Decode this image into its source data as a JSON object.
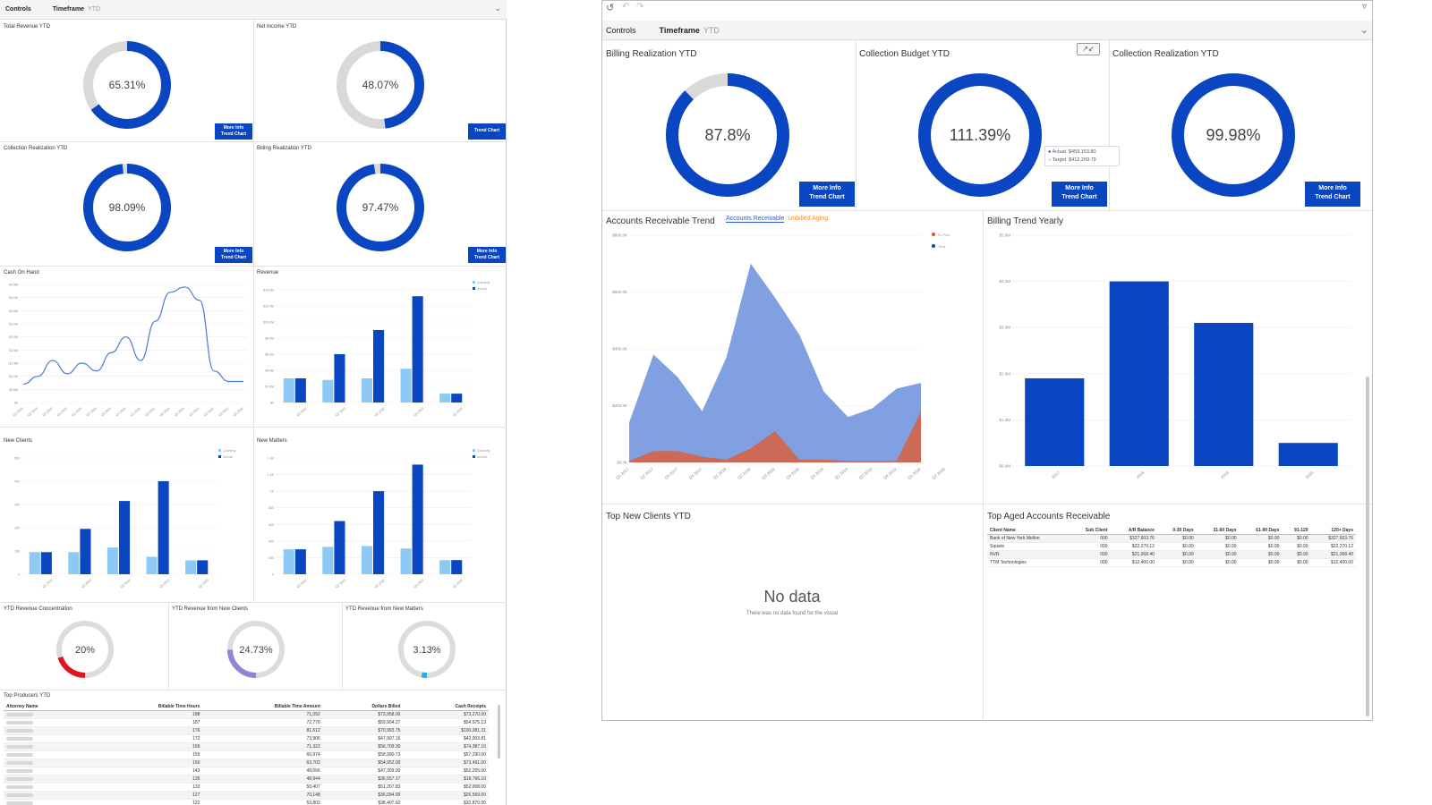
{
  "left": {
    "toolbar": {
      "controls": "Controls",
      "timeframe": "Timeframe",
      "timeframe_value": "YTD"
    },
    "donuts": [
      {
        "title": "Total Revenue YTD",
        "value": 65.31,
        "label": "65.31%",
        "button": [
          "More Info",
          "Trend Chart"
        ]
      },
      {
        "title": "Net Income YTD",
        "value": 48.07,
        "label": "48.07%",
        "button": [
          "Trend Chart"
        ]
      },
      {
        "title": "Collection Realization YTD",
        "value": 98.09,
        "label": "98.09%",
        "button": [
          "More Info",
          "Trend Chart"
        ]
      },
      {
        "title": "Billing Realization YTD",
        "value": 97.47,
        "label": "97.47%",
        "button": [
          "More Info",
          "Trend Chart"
        ]
      }
    ],
    "cash_title": "Cash On Hand",
    "revenue_title": "Revenue",
    "new_clients_title": "New Clients",
    "new_matters_title": "New Matters",
    "legend": {
      "quarterly": "Quarterly",
      "annual": "Annual"
    },
    "small_donuts": [
      {
        "title": "YTD Revenue Concentration",
        "value": 20,
        "label": "20%",
        "color": "#e0141e"
      },
      {
        "title": "YTD Revenue from New Clients",
        "value": 24.73,
        "label": "24.73%",
        "color": "#8e86d4"
      },
      {
        "title": "YTD Revenue from New Matters",
        "value": 3.13,
        "label": "3.13%",
        "color": "#22b3d6"
      }
    ],
    "producers": {
      "title": "Top Producers YTD",
      "headers": [
        "Attorney Name",
        "Billable Time Hours",
        "Billable Time Amount",
        "Dollars Billed",
        "Cash Receipts"
      ],
      "rows": [
        [
          "",
          "188",
          "71,092",
          "$73,958.00",
          "$73,270.00"
        ],
        [
          "",
          "187",
          "72,776",
          "$59,904.27",
          "$54,975.13"
        ],
        [
          "",
          "176",
          "81,612",
          "$70,993.75",
          "$100,081.31"
        ],
        [
          "",
          "172",
          "73,906",
          "$47,907.16",
          "$42,003.81"
        ],
        [
          "",
          "169",
          "71,322",
          "$56,709.30",
          "$74,387.10"
        ],
        [
          "",
          "159",
          "66,974",
          "$58,990.73",
          "$57,290.00"
        ],
        [
          "",
          "150",
          "63,702",
          "$54,952.00",
          "$73,491.00"
        ],
        [
          "",
          "143",
          "49,066",
          "$47,309.00",
          "$52,205.00"
        ],
        [
          "",
          "135",
          "48,944",
          "$36,557.17",
          "$18,766.10"
        ],
        [
          "",
          "133",
          "50,407",
          "$51,207.83",
          "$52,908.00"
        ],
        [
          "",
          "127",
          "70,148",
          "$36,094.00",
          "$26,569.00"
        ],
        [
          "",
          "122",
          "53,802",
          "$38,407.60",
          "$32,870.00"
        ]
      ]
    }
  },
  "right": {
    "toolbar": {
      "controls": "Controls",
      "timeframe": "Timeframe",
      "timeframe_value": "YTD"
    },
    "donuts": [
      {
        "title": "Billing Realization YTD",
        "value": 87.8,
        "label": "87.8%"
      },
      {
        "title": "Collection Budget YTD",
        "value": 100,
        "label": "111.39%"
      },
      {
        "title": "Collection Realization YTD",
        "value": 99.98,
        "label": "99.98%"
      }
    ],
    "button": [
      "More Info",
      "Trend Chart"
    ],
    "tooltip": {
      "actual_label": "Actual",
      "actual": "$459,153.80",
      "target_label": "Target",
      "target": "$412,209.79"
    },
    "ar_title": "Accounts Receivable Trend",
    "ar_tabs": [
      "Accounts Receivable",
      "Unbilled Aging"
    ],
    "ar_legend": [
      "91 Plus",
      "Total"
    ],
    "billing_title": "Billing Trend Yearly",
    "new_clients_title": "Top New Clients YTD",
    "no_data": "No data",
    "no_data_sub": "There was no data found for the visual",
    "aged": {
      "title": "Top Aged Accounts Receivable",
      "headers": [
        "Client Name",
        "Sub Client",
        "A/R Balance",
        "0-30 Days",
        "31-60 Days",
        "61-90 Days",
        "91-120",
        "120+ Days"
      ],
      "rows": [
        [
          "Bank of New York Mellon",
          "000",
          "$327,603.76",
          "$0.00",
          "$0.00",
          "$0.00",
          "$0.00",
          "$327,603.76"
        ],
        [
          "Square",
          "000",
          "$22,270.12",
          "$0.00",
          "$0.00",
          "$0.00",
          "$0.00",
          "$22,270.12"
        ],
        [
          "NVR",
          "000",
          "$21,068.40",
          "$0.00",
          "$0.00",
          "$0.00",
          "$0.00",
          "$21,068.40"
        ],
        [
          "TTM Technologies",
          "000",
          "$12,400.00",
          "$0.00",
          "$0.00",
          "$0.00",
          "$0.00",
          "$12,400.00"
        ]
      ]
    }
  },
  "chart_data": [
    {
      "type": "line",
      "title": "Cash On Hand",
      "x": [
        "Q1 2019",
        "Q2 2019",
        "Q3 2019",
        "Q4 2019",
        "Q1 2020",
        "Q2 2020",
        "Q3 2020",
        "Q4 2020",
        "Q1 2021",
        "Q2 2021",
        "Q3 2021",
        "Q4 2021",
        "Q1 2022",
        "Q2 2022",
        "Q3 2022",
        "Q4 2022"
      ],
      "y_ticks": [
        "$0",
        "$0.5M",
        "$1.0M",
        "$1.5M",
        "$2.0M",
        "$2.5M",
        "$3.0M",
        "$3.5M",
        "$4.0M",
        "$4.5M"
      ],
      "values": [
        0.7,
        1.0,
        1.6,
        1.1,
        1.5,
        1.2,
        1.9,
        2.5,
        1.6,
        3.1,
        4.2,
        4.4,
        3.9,
        1.2,
        0.8,
        0.8
      ],
      "ylim": [
        0,
        4.5
      ]
    },
    {
      "type": "bar",
      "title": "Revenue",
      "categories": [
        "Q1 2022",
        "Q2 2022",
        "Q3 2022",
        "Q4 2022",
        "Q1 2023"
      ],
      "series": [
        {
          "name": "Quarterly",
          "values": [
            3.0,
            2.8,
            3.0,
            4.2,
            1.1
          ]
        },
        {
          "name": "Annual",
          "values": [
            3.0,
            6.0,
            9.0,
            13.2,
            1.1
          ]
        }
      ],
      "y_ticks": [
        "$0",
        "$2.0M",
        "$4.0M",
        "$6.0M",
        "$8.0M",
        "$10.0M",
        "$12.0M",
        "$14.0M"
      ],
      "ylim": [
        0,
        14
      ]
    },
    {
      "type": "bar",
      "title": "New Clients",
      "categories": [
        "Q1 2022",
        "Q2 2022",
        "Q3 2022",
        "Q4 2022",
        "Q1 2023"
      ],
      "series": [
        {
          "name": "Quarterly",
          "values": [
            95,
            95,
            115,
            75,
            60
          ]
        },
        {
          "name": "Annual",
          "values": [
            95,
            195,
            315,
            400,
            60
          ]
        }
      ],
      "y_ticks": [
        "0",
        "100",
        "200",
        "300",
        "400",
        "500"
      ],
      "ylim": [
        0,
        500
      ]
    },
    {
      "type": "bar",
      "title": "New Matters",
      "categories": [
        "Q1 2022",
        "Q2 2022",
        "Q3 2022",
        "Q4 2022",
        "Q1 2023"
      ],
      "series": [
        {
          "name": "Quarterly",
          "values": [
            300,
            330,
            340,
            310,
            170
          ]
        },
        {
          "name": "Annual",
          "values": [
            300,
            640,
            1000,
            1320,
            170
          ]
        }
      ],
      "y_ticks": [
        "0",
        "200",
        "400",
        "600",
        "800",
        "1K",
        "1.2K",
        "1.4K"
      ],
      "ylim": [
        0,
        1400
      ]
    },
    {
      "type": "area",
      "title": "Accounts Receivable Trend",
      "x": [
        "Q1 2017",
        "Q2 2017",
        "Q3 2017",
        "Q4 2017",
        "Q1 2018",
        "Q2 2018",
        "Q3 2018",
        "Q4 2018",
        "Q1 2019",
        "Q2 2019",
        "Q3 2019",
        "Q4 2019",
        "Q1 2020",
        "Q2 2020"
      ],
      "series": [
        {
          "name": "Total",
          "values": [
            140,
            380,
            300,
            180,
            370,
            700,
            580,
            450,
            250,
            160,
            190,
            260,
            280,
            0
          ]
        },
        {
          "name": "91 Plus",
          "values": [
            5,
            40,
            40,
            20,
            10,
            50,
            110,
            10,
            10,
            5,
            5,
            5,
            180,
            0
          ]
        }
      ],
      "y_ticks": [
        "$0.0K",
        "$200.0K",
        "$400.0K",
        "$600.0K",
        "$800.0K"
      ],
      "ylim": [
        0,
        800
      ]
    },
    {
      "type": "bar",
      "title": "Billing Trend Yearly",
      "categories": [
        "2017",
        "2018",
        "2019",
        "2020"
      ],
      "values": [
        1.9,
        4.0,
        3.1,
        0.5
      ],
      "y_ticks": [
        "$0.0M",
        "$1.0M",
        "$2.0M",
        "$3.0M",
        "$4.0M",
        "$5.0M"
      ],
      "ylim": [
        0,
        5
      ]
    }
  ]
}
